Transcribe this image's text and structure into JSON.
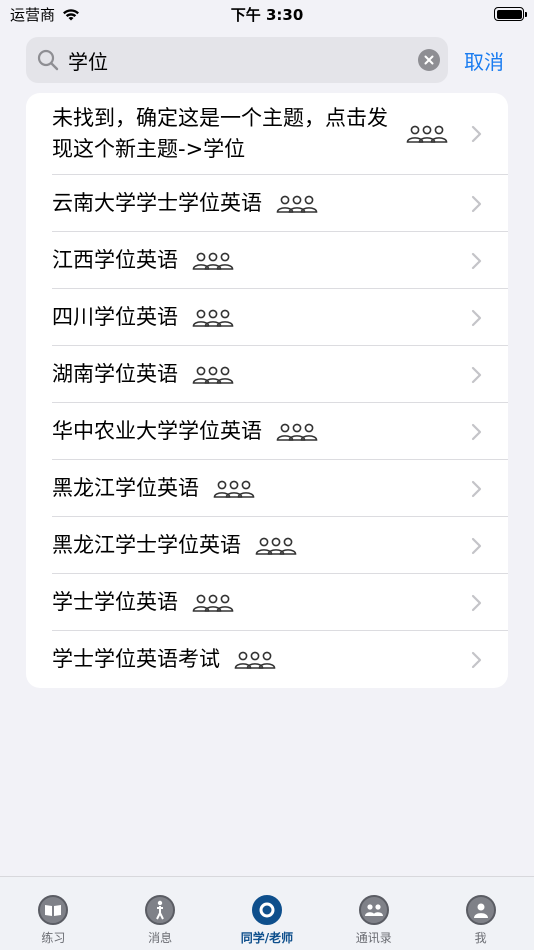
{
  "status_bar": {
    "carrier": "运营商",
    "time": "下午 3:30"
  },
  "search": {
    "value": "学位",
    "cancel_label": "取消"
  },
  "results": [
    {
      "label": "未找到，确定这是一个主题，点击发现这个新主题->学位"
    },
    {
      "label": "云南大学学士学位英语"
    },
    {
      "label": "江西学位英语"
    },
    {
      "label": "四川学位英语"
    },
    {
      "label": "湖南学位英语"
    },
    {
      "label": "华中农业大学学位英语"
    },
    {
      "label": "黑龙江学位英语"
    },
    {
      "label": "黑龙江学士学位英语"
    },
    {
      "label": "学士学位英语"
    },
    {
      "label": "学士学位英语考试"
    }
  ],
  "tabs": [
    {
      "label": "练习",
      "icon": "book-icon"
    },
    {
      "label": "消息",
      "icon": "person-walk-icon"
    },
    {
      "label": "同学/老师",
      "icon": "circle-icon",
      "active": true
    },
    {
      "label": "通讯录",
      "icon": "contacts-icon"
    },
    {
      "label": "我",
      "icon": "profile-icon"
    }
  ],
  "colors": {
    "accent": "#1a7cf0",
    "active_tab": "#0e4f8c",
    "background": "#f2f2f7"
  }
}
